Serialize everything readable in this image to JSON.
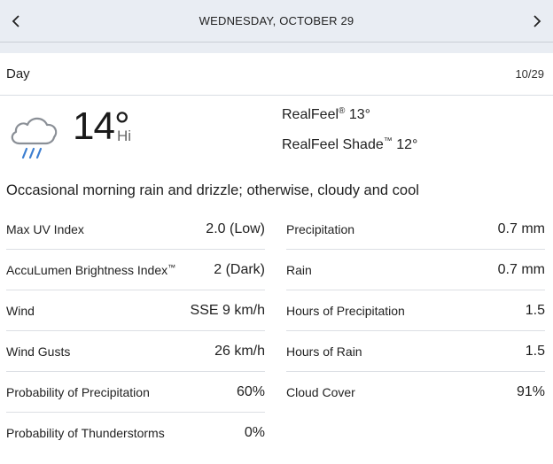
{
  "header": {
    "date": "WEDNESDAY, OCTOBER 29",
    "prev_icon": "chevron-left-icon",
    "next_icon": "chevron-right-icon"
  },
  "day_row": {
    "label": "Day",
    "short_date": "10/29"
  },
  "current": {
    "icon": "cloud-rain-icon",
    "temperature": "14°",
    "hi_label": "Hi",
    "realfeel_label": "RealFeel",
    "realfeel_mark": "®",
    "realfeel_value": " 13°",
    "realfeel_shade_label": "RealFeel Shade",
    "realfeel_shade_mark": "™",
    "realfeel_shade_value": " 12°"
  },
  "phrase": "Occasional morning rain and drizzle; otherwise, cloudy and cool",
  "left_details": [
    {
      "label": "Max UV Index",
      "value": "2.0 (Low)"
    },
    {
      "label": "AccuLumen Brightness Index",
      "mark": "™",
      "value": "2 (Dark)"
    },
    {
      "label": "Wind",
      "value": "SSE 9 km/h"
    },
    {
      "label": "Wind Gusts",
      "value": "26 km/h"
    },
    {
      "label": "Probability of Precipitation",
      "value": "60%"
    },
    {
      "label": "Probability of Thunderstorms",
      "value": "0%"
    }
  ],
  "right_details": [
    {
      "label": "Precipitation",
      "value": "0.7 mm"
    },
    {
      "label": "Rain",
      "value": "0.7 mm"
    },
    {
      "label": "Hours of Precipitation",
      "value": "1.5"
    },
    {
      "label": "Hours of Rain",
      "value": "1.5"
    },
    {
      "label": "Cloud Cover",
      "value": "91%"
    }
  ]
}
